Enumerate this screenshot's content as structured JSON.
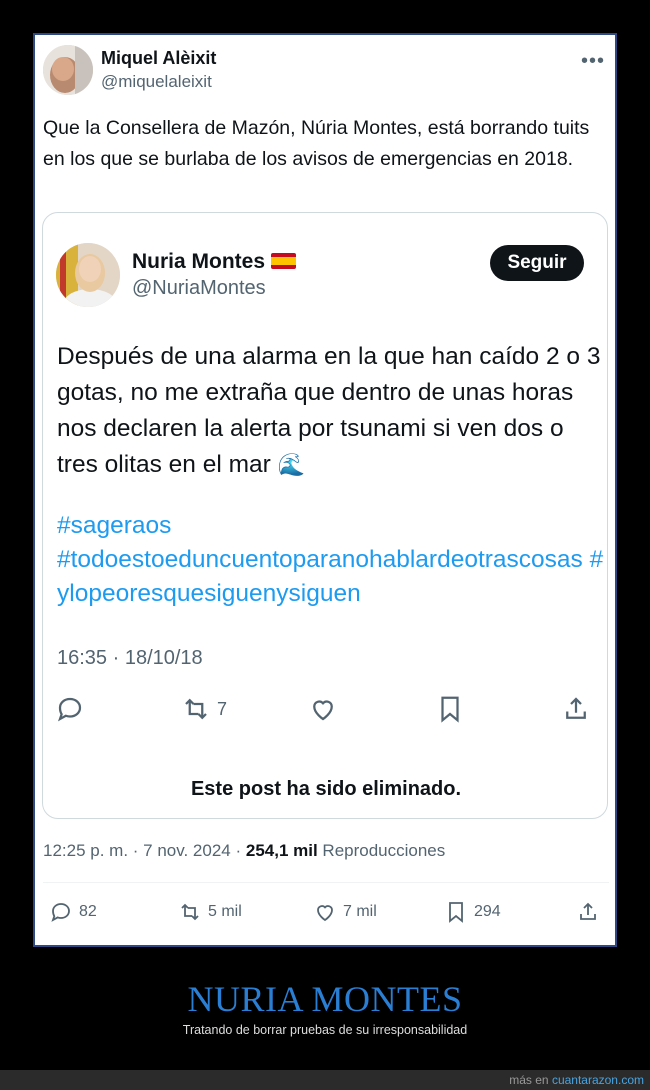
{
  "tweet": {
    "author_name": "Miquel Alèixit",
    "author_handle": "@miquelaleixit",
    "more_icon": "more-options-icon",
    "text": "Que la Consellera de Mazón, Núria Montes, está borrando tuits en los que se burlaba de los avisos de emergencias en 2018.",
    "timestamp": "12:25 p. m. · 7 nov. 2024 · ",
    "views_count": "254,1 mil",
    "views_label": " Reproducciones",
    "actions": {
      "replies": "82",
      "reposts": "5 mil",
      "likes": "7 mil",
      "bookmarks": "294"
    }
  },
  "quoted": {
    "author_name": "Nuria Montes",
    "author_handle": "@NuriaMontes",
    "follow_label": "Seguir",
    "body": "Después de una alarma en la que han caído 2 o 3 gotas, no me extraña que dentro de unas horas nos declaren la alerta por tsunami si ven dos o tres olitas en el mar",
    "wave_emoji": "🌊",
    "hashtags": [
      "#sageraos",
      "#todoestoeduncuentoparanohablardeotrascosas",
      "#ylopeoresquesiguenysiguen"
    ],
    "timestamp": "16:35 · 18/10/18",
    "reposts": "7",
    "removed_notice": "Este post ha sido eliminado."
  },
  "banner": {
    "title": "NURIA MONTES",
    "subtitle": "Tratando de borrar pruebas de su irresponsabilidad"
  },
  "footer": {
    "prefix": "más en ",
    "site": "cuantarazon.com"
  },
  "colors": {
    "link": "#1d9bf0",
    "banner_title": "#2a7fd4",
    "frame_border": "#2d4a86"
  }
}
